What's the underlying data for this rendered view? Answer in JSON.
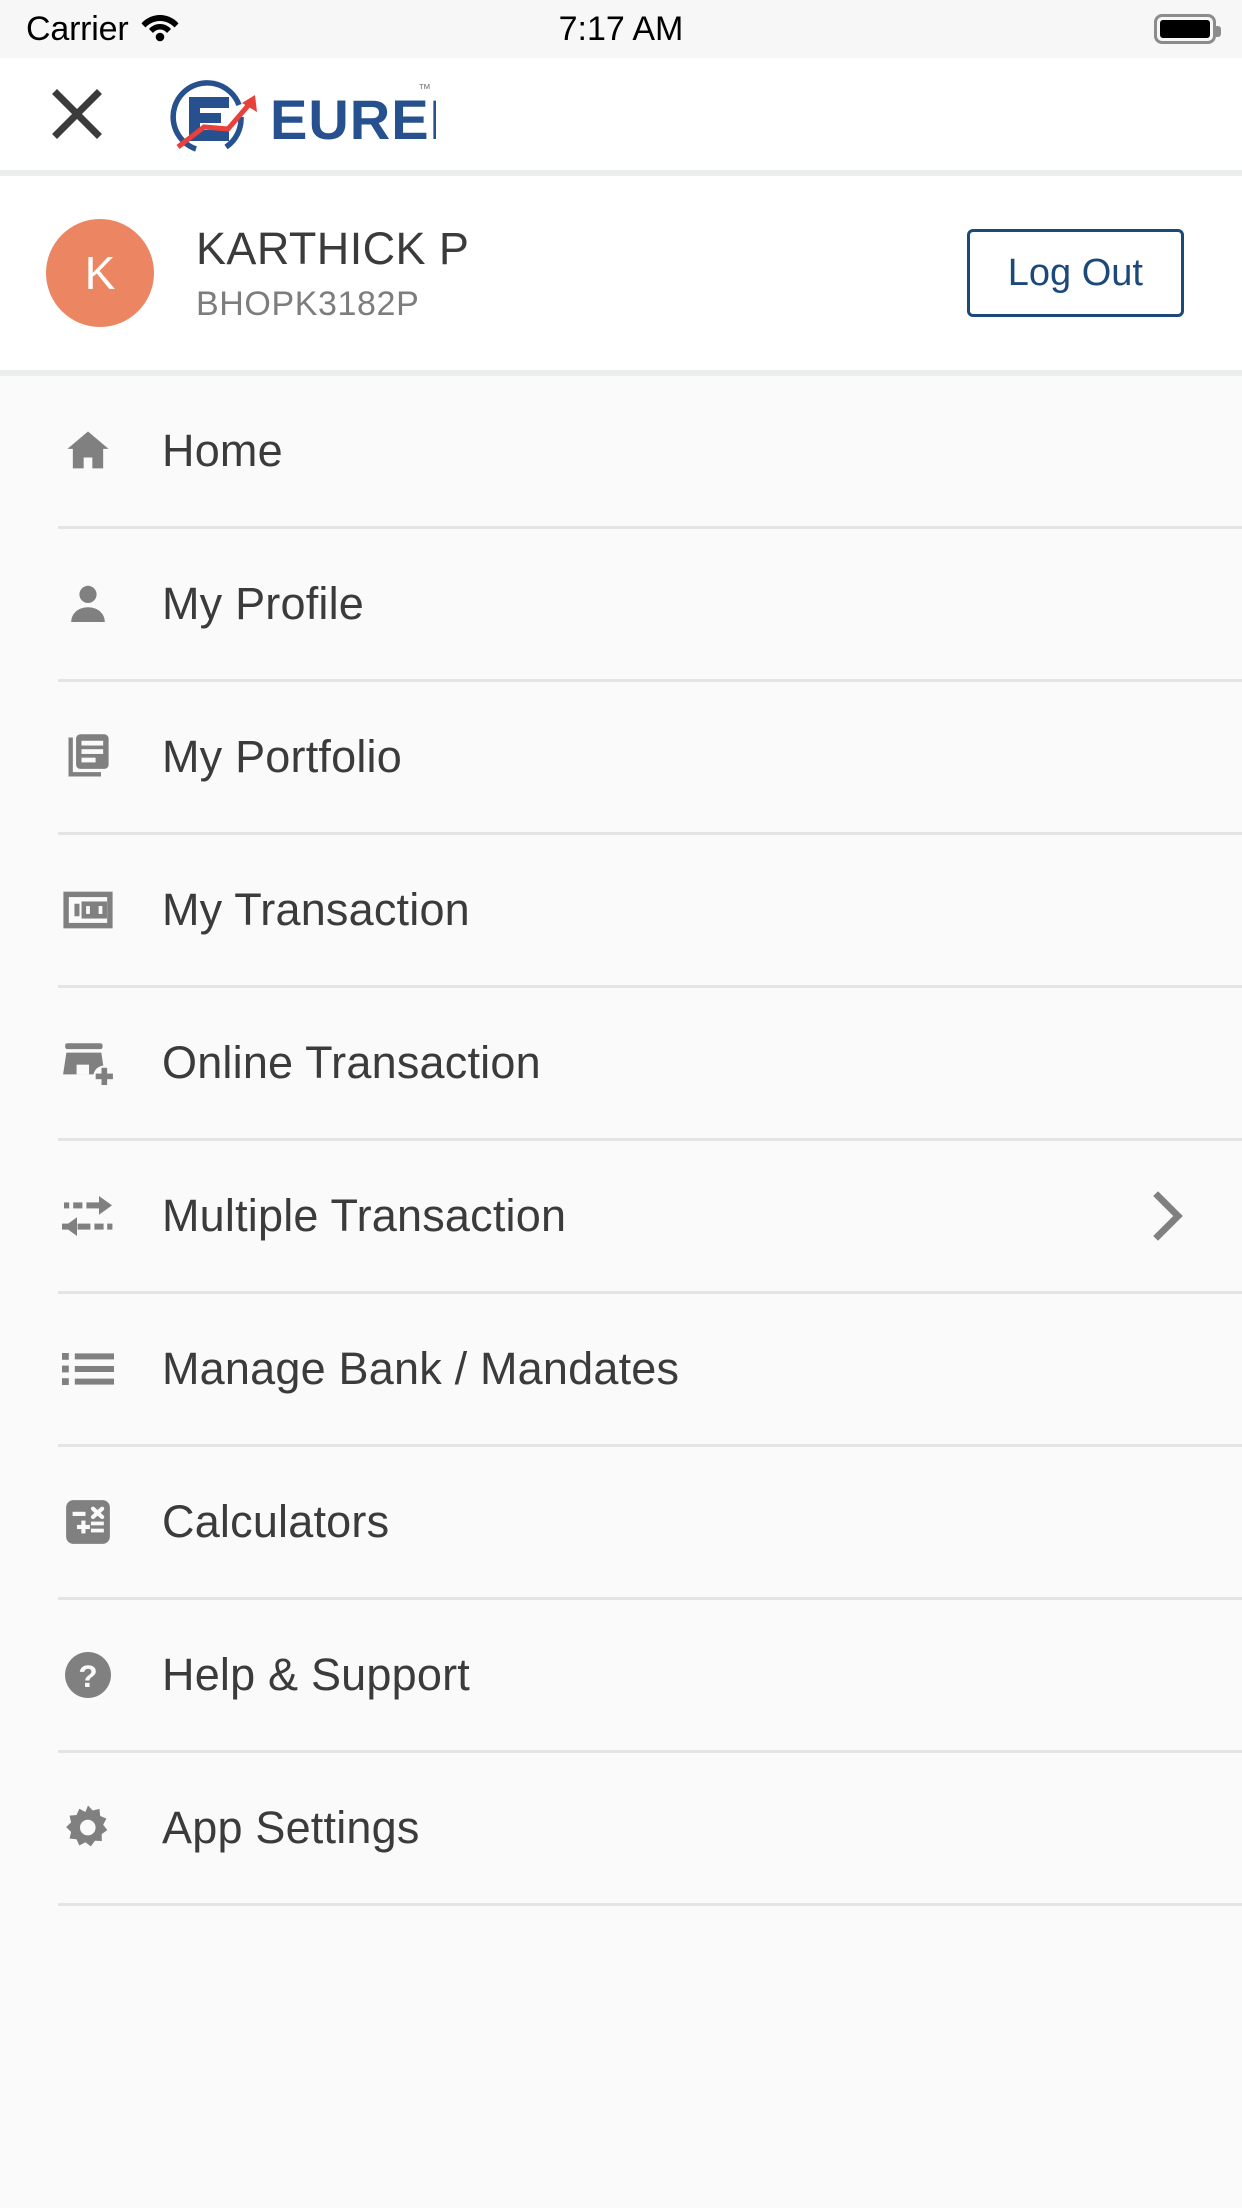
{
  "status_bar": {
    "carrier": "Carrier",
    "time": "7:17 AM",
    "wifi_icon": "wifi-icon",
    "battery_icon": "battery-full-icon"
  },
  "header": {
    "close_icon": "close-icon",
    "brand_name": "EUREKA",
    "brand_trademark": "™",
    "brand_color": "#27508f",
    "brand_accent_color": "#e8403a"
  },
  "profile": {
    "avatar_initial": "K",
    "avatar_color": "#ec8562",
    "name": "KARTHICK P",
    "pan": "BHOPK3182P",
    "logout_label": "Log Out",
    "logout_color": "#1b4a7a"
  },
  "menu": {
    "items": [
      {
        "label": "Home",
        "icon": "home-icon",
        "has_chevron": false
      },
      {
        "label": "My Profile",
        "icon": "person-icon",
        "has_chevron": false
      },
      {
        "label": "My Portfolio",
        "icon": "documents-icon",
        "has_chevron": false
      },
      {
        "label": "My Transaction",
        "icon": "money-100-icon",
        "has_chevron": false
      },
      {
        "label": "Online Transaction",
        "icon": "store-add-icon",
        "has_chevron": false
      },
      {
        "label": "Multiple Transaction",
        "icon": "swap-arrows-icon",
        "has_chevron": true
      },
      {
        "label": "Manage Bank / Mandates",
        "icon": "list-icon",
        "has_chevron": false
      },
      {
        "label": "Calculators",
        "icon": "calculator-icon",
        "has_chevron": false
      },
      {
        "label": "Help & Support",
        "icon": "question-circle-icon",
        "has_chevron": false
      },
      {
        "label": "App Settings",
        "icon": "gear-icon",
        "has_chevron": false
      }
    ],
    "chevron_icon": "chevron-right-icon",
    "icon_color": "#808080"
  }
}
